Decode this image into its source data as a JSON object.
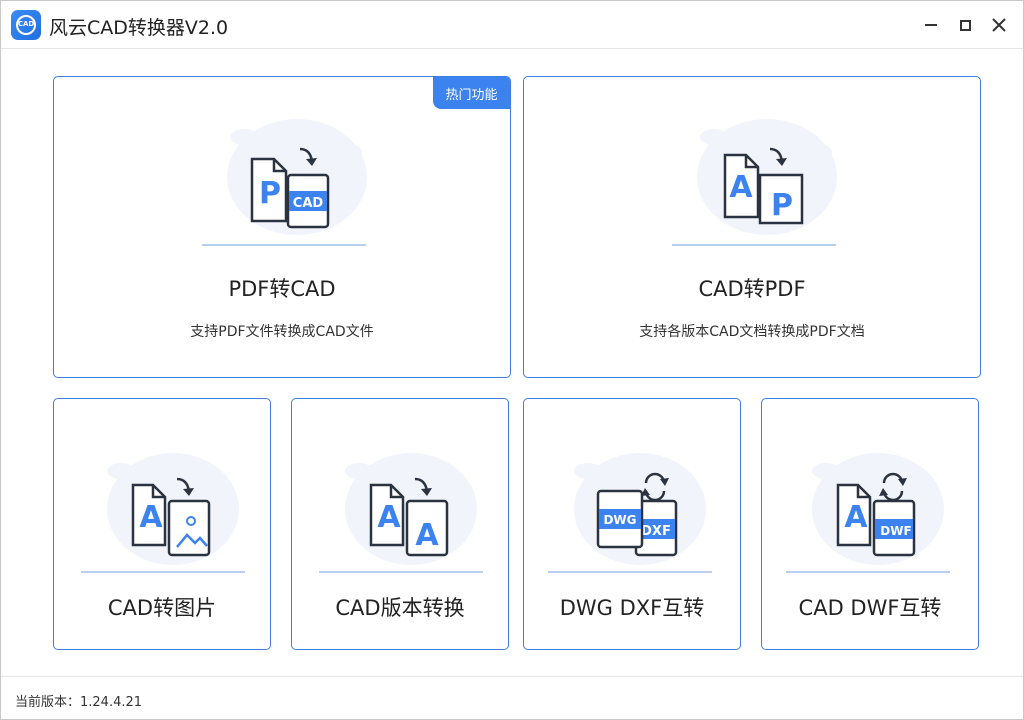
{
  "app": {
    "title": "风云CAD转换器V2.0",
    "logo_text": "CAD"
  },
  "cards": {
    "pdf_to_cad": {
      "badge": "热门功能",
      "title": "PDF转CAD",
      "desc": "支持PDF文件转换成CAD文件",
      "icon_front": "P",
      "icon_back": "CAD"
    },
    "cad_to_pdf": {
      "title": "CAD转PDF",
      "desc": "支持各版本CAD文档转换成PDF文档",
      "icon_front": "A",
      "icon_back": "P"
    },
    "cad_to_image": {
      "title": "CAD转图片",
      "icon_front": "A"
    },
    "cad_version": {
      "title": "CAD版本转换",
      "icon_front": "A",
      "icon_back": "A"
    },
    "dwg_dxf": {
      "title": "DWG DXF互转",
      "icon_front": "DWG",
      "icon_back": "DXF"
    },
    "cad_dwf": {
      "title": "CAD DWF互转",
      "icon_front": "A",
      "icon_back": "DWF"
    }
  },
  "status": {
    "version_text": "当前版本：1.24.4.21"
  },
  "colors": {
    "accent": "#3c83f0",
    "card_border": "#3d7fe0",
    "icon_dark": "#2b3340"
  }
}
